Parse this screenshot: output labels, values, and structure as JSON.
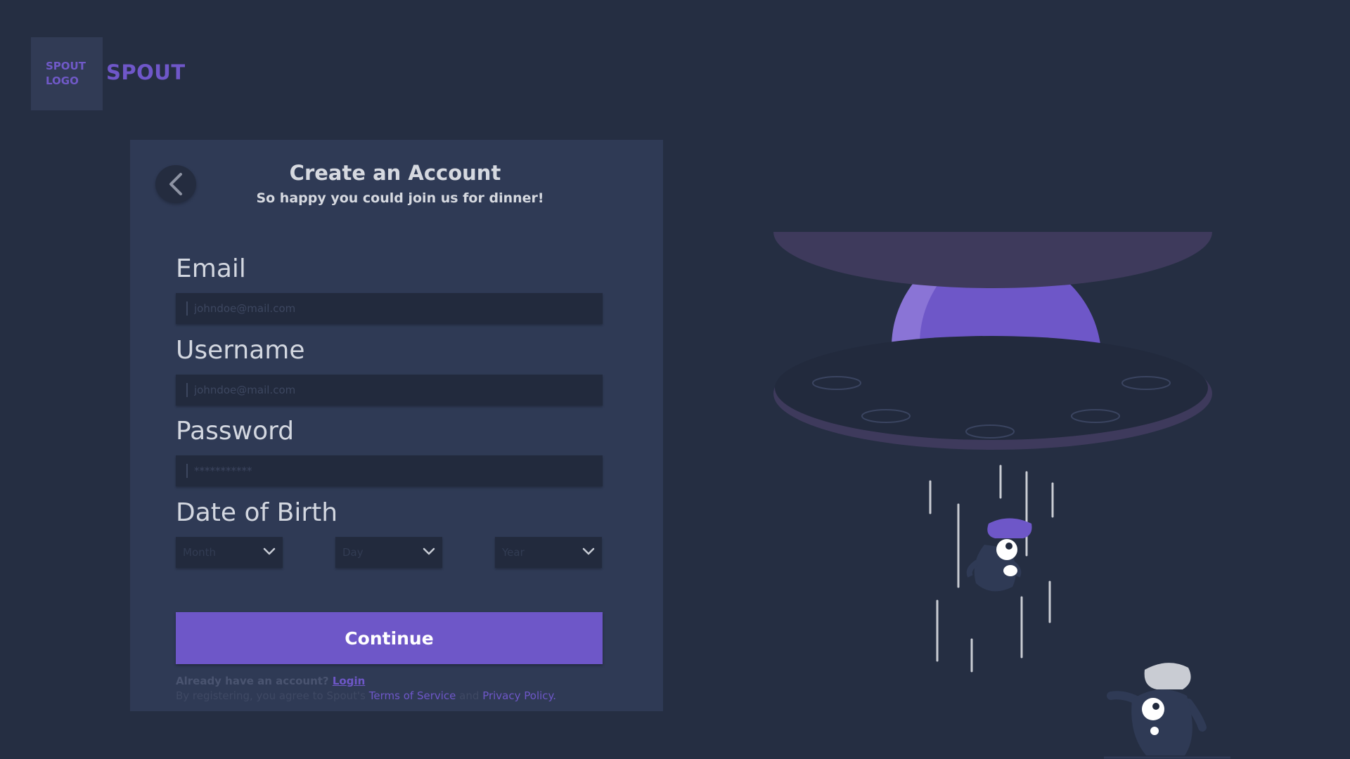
{
  "brand": {
    "logo_text": "SPOUT LOGO",
    "name": "SPOUT"
  },
  "form": {
    "title": "Create an Account",
    "subtitle": "So happy you could join us for dinner!",
    "email": {
      "label": "Email",
      "placeholder": "johndoe@mail.com",
      "value": ""
    },
    "username": {
      "label": "Username",
      "placeholder": "johndoe@mail.com",
      "value": ""
    },
    "password": {
      "label": "Password",
      "placeholder": "***********",
      "value": ""
    },
    "dob": {
      "label": "Date of Birth",
      "month": "Month",
      "day": "Day",
      "year": "Year"
    },
    "continue_label": "Continue",
    "login_prompt": "Already have an account?",
    "login_link": "Login",
    "legal_prefix": "By registering, you agree to Spout's",
    "terms_link": "Terms of Service",
    "legal_and": "and",
    "privacy_link": "Privacy Policy."
  },
  "icons": {
    "back": "back-arrow-icon",
    "dropdown": "chevron-down-icon"
  },
  "colors": {
    "background": "#252e42",
    "card": "#2f3a55",
    "input": "#222a3d",
    "accent": "#6e57c8"
  }
}
